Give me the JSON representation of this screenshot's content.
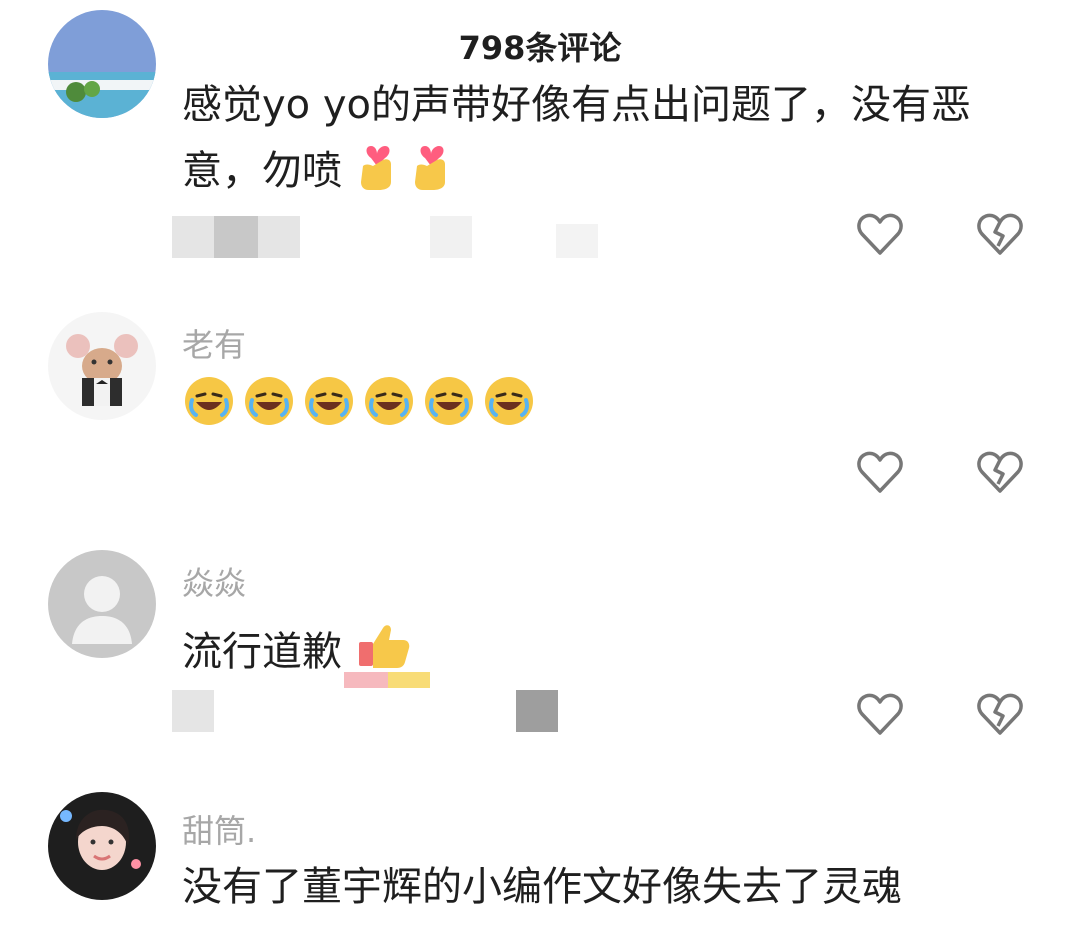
{
  "header": {
    "title": "798条评论"
  },
  "comments": [
    {
      "username": "",
      "text": "感觉yo yo的声带好像有点出问题了，没有恶意，勿喷",
      "emojis": [
        "finger-heart-emoji",
        "finger-heart-emoji"
      ],
      "avatar": "landscape-avatar"
    },
    {
      "username": "老有",
      "text": "",
      "emojis": [
        "laughing-crying-emoji",
        "laughing-crying-emoji",
        "laughing-crying-emoji",
        "laughing-crying-emoji",
        "laughing-crying-emoji",
        "laughing-crying-emoji"
      ],
      "avatar": "mouse-avatar"
    },
    {
      "username": "焱焱",
      "text": "流行道歉",
      "emojis": [
        "thumbs-up-emoji"
      ],
      "avatar": "default-avatar"
    },
    {
      "username": "甜筒.",
      "text": "没有了董宇辉的小编作文好像失去了灵魂",
      "emojis": [],
      "avatar": "girl-avatar"
    }
  ],
  "icons": {
    "like": "heart-outline-icon",
    "dislike": "broken-heart-icon"
  },
  "colors": {
    "username": "#a7a7a7",
    "text": "#1f1f1f",
    "icon": "#777777"
  }
}
